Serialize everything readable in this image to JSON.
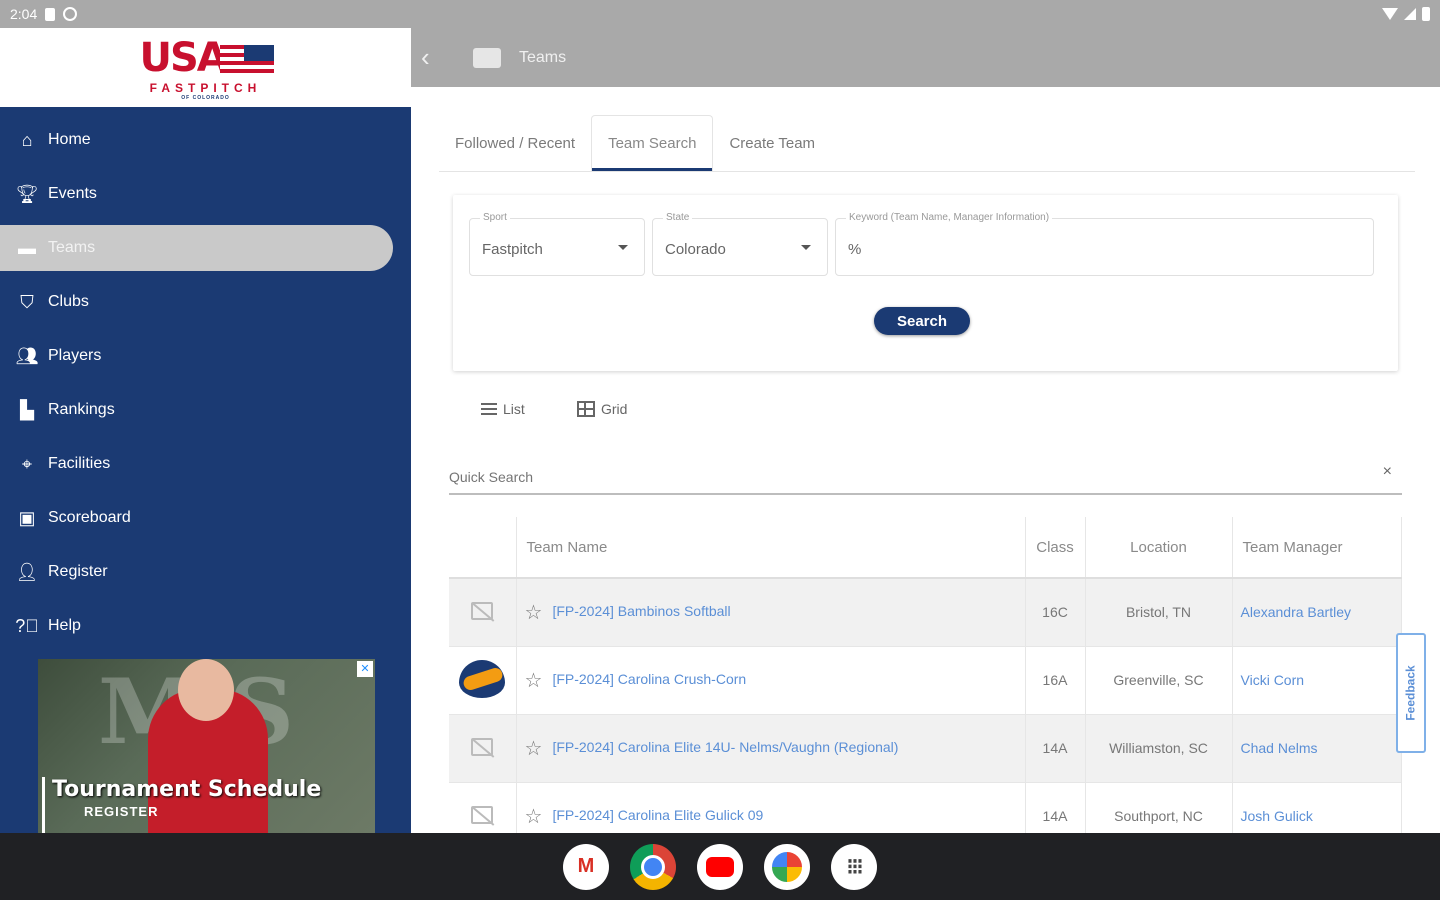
{
  "status_bar": {
    "time": "2:04"
  },
  "logo": {
    "brand": "USA",
    "subtitle": "FASTPITCH",
    "tagline": "OF COLORADO"
  },
  "sidebar": {
    "items": [
      {
        "label": "Home",
        "icon": "home-icon"
      },
      {
        "label": "Events",
        "icon": "trophy-icon"
      },
      {
        "label": "Teams",
        "icon": "briefcase-icon",
        "active": true
      },
      {
        "label": "Clubs",
        "icon": "shield-icon"
      },
      {
        "label": "Players",
        "icon": "people-icon"
      },
      {
        "label": "Rankings",
        "icon": "podium-icon"
      },
      {
        "label": "Facilities",
        "icon": "location-icon"
      },
      {
        "label": "Scoreboard",
        "icon": "scoreboard-icon"
      },
      {
        "label": "Register",
        "icon": "person-add-icon"
      },
      {
        "label": "Help",
        "icon": "help-icon"
      }
    ]
  },
  "ad": {
    "title": "Tournament Schedule",
    "cta": "REGISTER"
  },
  "topbar": {
    "title": "Teams"
  },
  "tabs": [
    {
      "label": "Followed / Recent"
    },
    {
      "label": "Team Search",
      "active": true
    },
    {
      "label": "Create Team"
    }
  ],
  "search_form": {
    "sport": {
      "label": "Sport",
      "value": "Fastpitch"
    },
    "state": {
      "label": "State",
      "value": "Colorado"
    },
    "keyword": {
      "label": "Keyword (Team Name, Manager Information)",
      "value": "%"
    },
    "button": "Search"
  },
  "view": {
    "list_label": "List",
    "grid_label": "Grid"
  },
  "quick_search": {
    "placeholder": "Quick Search",
    "clear": "×"
  },
  "table": {
    "headers": {
      "name": "Team Name",
      "class": "Class",
      "location": "Location",
      "manager": "Team Manager"
    },
    "rows": [
      {
        "name": "[FP-2024] Bambinos Softball",
        "class": "16C",
        "location": "Bristol, TN",
        "manager": "Alexandra Bartley",
        "has_logo": false
      },
      {
        "name": "[FP-2024] Carolina Crush-Corn",
        "class": "16A",
        "location": "Greenville, SC",
        "manager": "Vicki Corn",
        "has_logo": true
      },
      {
        "name": "[FP-2024] Carolina Elite 14U- Nelms/Vaughn (Regional)",
        "class": "14A",
        "location": "Williamston, SC",
        "manager": "Chad Nelms",
        "has_logo": false
      },
      {
        "name": "[FP-2024] Carolina Elite Gulick 09",
        "class": "14A",
        "location": "Southport, NC",
        "manager": "Josh Gulick",
        "has_logo": false
      }
    ]
  },
  "feedback": {
    "label": "Feedback"
  },
  "dock": [
    "Gmail",
    "Chrome",
    "YouTube",
    "Photos",
    "Launcher"
  ]
}
